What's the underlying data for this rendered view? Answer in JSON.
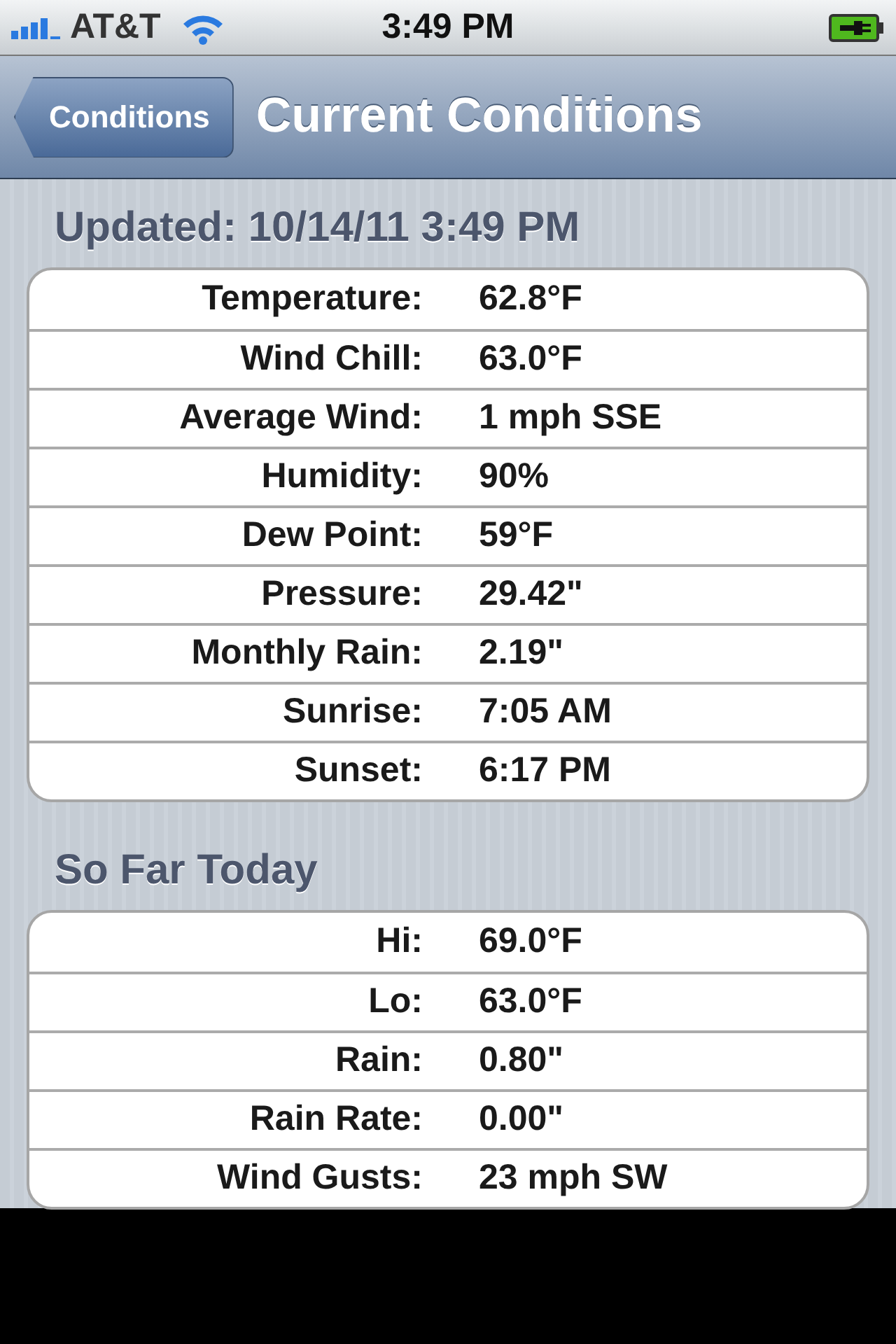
{
  "status_bar": {
    "carrier": "AT&T",
    "time": "3:49 PM"
  },
  "nav_bar": {
    "back_button": "Conditions",
    "title": "Current Conditions"
  },
  "sections": [
    {
      "header": "Updated: 10/14/11 3:49 PM",
      "rows": [
        {
          "label": "Temperature:",
          "value": "62.8°F"
        },
        {
          "label": "Wind Chill:",
          "value": "63.0°F"
        },
        {
          "label": "Average Wind:",
          "value": "1 mph SSE"
        },
        {
          "label": "Humidity:",
          "value": "90%"
        },
        {
          "label": "Dew Point:",
          "value": "59°F"
        },
        {
          "label": "Pressure:",
          "value": "29.42\""
        },
        {
          "label": "Monthly Rain:",
          "value": "2.19\""
        },
        {
          "label": "Sunrise:",
          "value": "7:05 AM"
        },
        {
          "label": "Sunset:",
          "value": "6:17 PM"
        }
      ]
    },
    {
      "header": "So Far Today",
      "rows": [
        {
          "label": "Hi:",
          "value": "69.0°F"
        },
        {
          "label": "Lo:",
          "value": "63.0°F"
        },
        {
          "label": "Rain:",
          "value": "0.80\""
        },
        {
          "label": "Rain Rate:",
          "value": "0.00\""
        },
        {
          "label": "Wind Gusts:",
          "value": "23 mph SW"
        }
      ]
    }
  ]
}
